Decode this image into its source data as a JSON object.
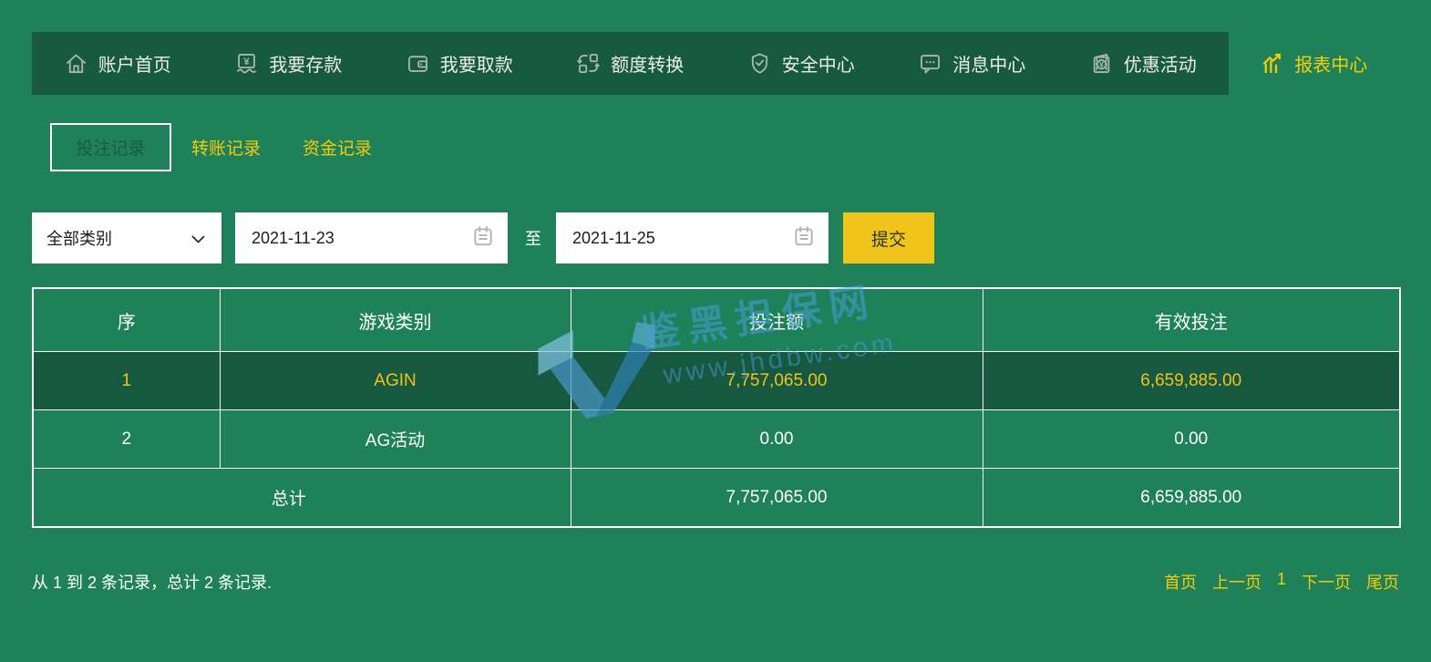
{
  "colors": {
    "page_bg": "#1e8159",
    "nav_bg": "#175a40",
    "row_highlight_bg": "#165840",
    "accent_yellow": "#f0c419",
    "button_yellow": "#f0c41b",
    "watermark_blue": "#489edb"
  },
  "nav": {
    "items": [
      {
        "label": "账户首页",
        "icon": "home-icon",
        "active": false
      },
      {
        "label": "我要存款",
        "icon": "deposit-icon",
        "active": false
      },
      {
        "label": "我要取款",
        "icon": "withdraw-wallet-icon",
        "active": false
      },
      {
        "label": "额度转换",
        "icon": "transfer-cycle-icon",
        "active": false
      },
      {
        "label": "安全中心",
        "icon": "shield-check-icon",
        "active": false
      },
      {
        "label": "消息中心",
        "icon": "message-bubble-icon",
        "active": false
      },
      {
        "label": "优惠活动",
        "icon": "promo-packet-icon",
        "active": false
      },
      {
        "label": "报表中心",
        "icon": "report-chart-icon",
        "active": true
      }
    ]
  },
  "tabs": {
    "items": [
      {
        "label": "投注记录",
        "active": true
      },
      {
        "label": "转账记录",
        "active": false
      },
      {
        "label": "资金记录",
        "active": false
      }
    ]
  },
  "filters": {
    "category_selected": "全部类别",
    "start_date": "2021-11-23",
    "between_label": "至",
    "end_date": "2021-11-25",
    "submit_label": "提交"
  },
  "table": {
    "columns": [
      "序",
      "游戏类别",
      "投注额",
      "有效投注"
    ],
    "rows": [
      {
        "no": "1",
        "game": "AGIN",
        "bet_amount": "7,757,065.00",
        "valid_bet": "6,659,885.00",
        "highlighted": true
      },
      {
        "no": "2",
        "game": "AG活动",
        "bet_amount": "0.00",
        "valid_bet": "0.00",
        "highlighted": false
      }
    ],
    "total": {
      "label": "总计",
      "bet_amount": "7,757,065.00",
      "valid_bet": "6,659,885.00"
    }
  },
  "footer": {
    "records_summary": "从 1 到 2 条记录，总计 2 条记录.",
    "pagination": {
      "first": "首页",
      "prev": "上一页",
      "current": "1",
      "next": "下一页",
      "last": "尾页"
    }
  },
  "watermark": {
    "site_name": "鉴黑担保网",
    "url": "www.jhdbw.com"
  }
}
